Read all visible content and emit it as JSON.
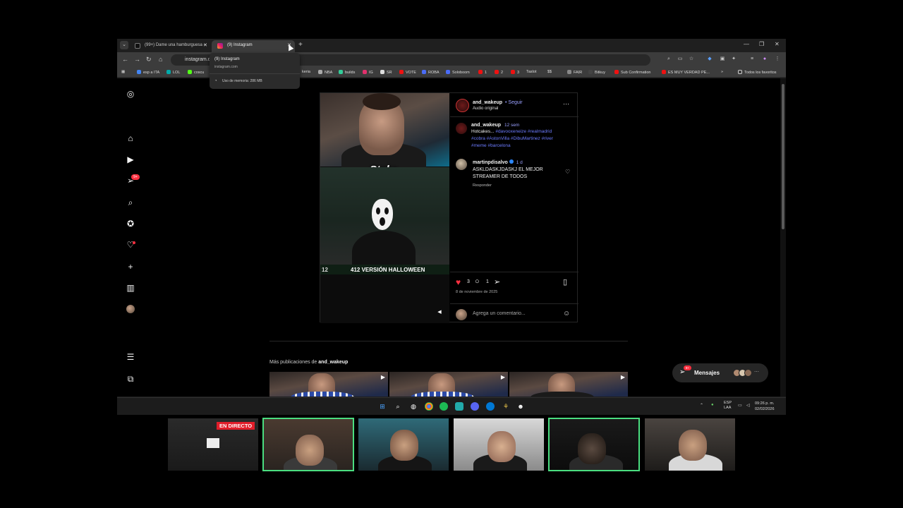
{
  "browser": {
    "tabs": [
      {
        "label": "(99+) Dame una hamburguesa -",
        "active": false
      },
      {
        "label": "(9) Instagram",
        "active": true
      }
    ],
    "url": "instagram.com",
    "hovercard": {
      "title": "(9) Instagram",
      "url": "instagram.com",
      "memory": "Uso de memoria: 286 MB"
    },
    "bookmarks": [
      "esp a ITA",
      "LOL",
      "coscu",
      "keria",
      "NBA",
      "builds",
      "IG",
      "SR",
      "VOTE",
      "ROBA",
      "Soloboom",
      "1",
      "2",
      "3",
      "Taslot",
      "$$",
      "FAIR",
      "Bitkuy",
      "Sub Confirmation",
      "ES MUY VERDAD PE..."
    ],
    "all_bookmarks": "Todos los favoritos"
  },
  "instagram": {
    "notification_badge": "9+",
    "post": {
      "username": "and_wakeup",
      "follow": "Seguir",
      "audio": "Audio original",
      "media_text": "Stake",
      "media_caption": "412 VERSIÓN HALLOWEEN",
      "media_caption_number": "12",
      "caption_user": "and_wakeup",
      "caption_time": "12 sem",
      "caption_text": "Hotcakes...",
      "caption_tags_line1": "#davooxeneize #realmadrid",
      "caption_tags_line2": "#cobra #AstonVilla #DibuMartinez #river",
      "caption_tags_line3": "#meme #barcelona",
      "comment_user": "martinpdisalvo",
      "comment_time": "1 d",
      "comment_text": "ASKLDASKJDASKJ EL MEJOR STREAMER DE TODOS",
      "reply": "Responder",
      "likes": "3",
      "comments": "1",
      "date": "8 de noviembre de 2025",
      "add_comment_placeholder": "Agrega un comentario..."
    },
    "more_posts_prefix": "Más publicaciones de",
    "more_posts_user": "and_wakeup",
    "messages": {
      "label": "Mensajes",
      "badge": "9+"
    }
  },
  "taskbar": {
    "lang_line1": "ESP",
    "lang_line2": "LAA",
    "time": "09:26 p. m.",
    "date": "02/02/2026"
  },
  "stream": {
    "live_label": "EN DIRECTO"
  },
  "colors": {
    "accent_like": "#ff3040",
    "link": "#6d7cff",
    "live": "#e11d2a",
    "active_cam": "#4ade80"
  }
}
